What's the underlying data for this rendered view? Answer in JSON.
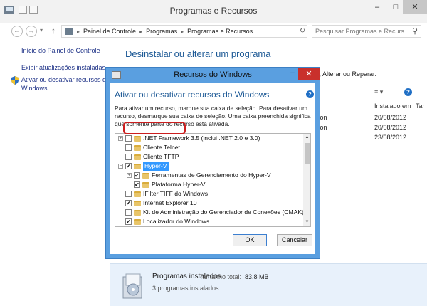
{
  "window": {
    "title": "Programas e Recursos"
  },
  "address": {
    "crumbs": [
      "Painel de Controle",
      "Programas",
      "Programas e Recursos"
    ],
    "search_placeholder": "Pesquisar Programas e Recurs..."
  },
  "left": {
    "links": [
      "Início do Painel de Controle",
      "Exibir atualizações instaladas",
      "Ativar ou desativar recursos do",
      "Windows"
    ]
  },
  "content": {
    "title": "Desinstalar ou alterar um programa",
    "subtitle_partial": "r, Alterar ou Reparar.",
    "columns": {
      "installed": "Instalado em",
      "size_partial": "Tar"
    },
    "rows": [
      {
        "name_partial": "ation",
        "date": "20/08/2012"
      },
      {
        "name_partial": "ation",
        "date": "20/08/2012"
      },
      {
        "name_partial": "",
        "date": "23/08/2012"
      }
    ]
  },
  "status": {
    "title": "Programas instalados",
    "size_label": "Tamanho total:",
    "size_value": "83,8 MB",
    "count": "3 programas instalados"
  },
  "dialog": {
    "title": "Recursos do Windows",
    "heading": "Ativar ou desativar recursos do Windows",
    "description": "Para ativar um recurso, marque sua caixa de seleção. Para desativar um recurso, desmarque sua caixa de seleção. Uma caixa preenchida significa que somente parte do recurso está ativada.",
    "features": [
      {
        "label": ".NET Framework 3.5 (inclui .NET 2.0 e 3.0)",
        "expander": "+",
        "state": "unchecked",
        "level": 0
      },
      {
        "label": "Cliente Telnet",
        "expander": "",
        "state": "unchecked",
        "level": 0
      },
      {
        "label": "Cliente TFTP",
        "expander": "",
        "state": "unchecked",
        "level": 0
      },
      {
        "label": "Hyper-V",
        "expander": "−",
        "state": "checked",
        "level": 0
      },
      {
        "label": "Ferramentas de Gerenciamento do Hyper-V",
        "expander": "+",
        "state": "checked",
        "level": 1
      },
      {
        "label": "Plataforma Hyper-V",
        "expander": "",
        "state": "checked",
        "level": 1
      },
      {
        "label": "IFilter TIFF do Windows",
        "expander": "",
        "state": "unchecked",
        "level": 0
      },
      {
        "label": "Internet Explorer 10",
        "expander": "",
        "state": "checked",
        "level": 0
      },
      {
        "label": "Kit de Administração do Gerenciador de Conexões (CMAK) R",
        "expander": "",
        "state": "unchecked",
        "level": 0
      },
      {
        "label": "Localizador do Windows",
        "expander": "",
        "state": "checked",
        "level": 0
      }
    ],
    "ok_label": "OK",
    "cancel_label": "Cancelar"
  }
}
